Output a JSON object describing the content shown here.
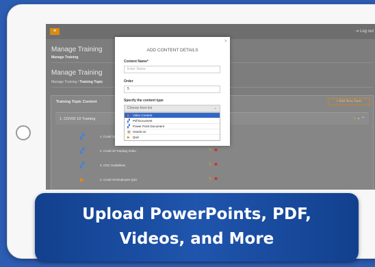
{
  "topbar": {
    "menu_glyph": "≡",
    "login_label": "Log out"
  },
  "page": {
    "title_1": "Manage Training",
    "subtitle_1": "Manage Training",
    "title_2": "Manage Training",
    "breadcrumb": [
      "Manage Training",
      "/",
      "Training Topic"
    ]
  },
  "panel": {
    "title": "Training Topic Content",
    "add_button": "+ Add New Topic",
    "topic": "1. COVID 19 Training",
    "items": [
      {
        "label": "1. Covid 19 C",
        "icon": "pdf-icon"
      },
      {
        "label": "2. Covid 19 Training Video",
        "icon": "pdf-icon"
      },
      {
        "label": "3. CDC Guidelines",
        "icon": "pdf-icon"
      },
      {
        "label": "4. Covid 19 Employee Quiz",
        "icon": "quiz-icon"
      }
    ]
  },
  "modal": {
    "close": "×",
    "title": "ADD CONTENT DETAILS",
    "content_name_label": "Content Name*",
    "content_name_placeholder": "Enter Name",
    "order_label": "Order",
    "order_value": "5",
    "type_label": "Specify the content type",
    "type_placeholder": "Choose from list",
    "options": [
      {
        "label": "Video Content",
        "selected": true,
        "icon": "video-icon"
      },
      {
        "label": "Pdf Document",
        "selected": false,
        "icon": "pdf-icon"
      },
      {
        "label": "Power Point Document",
        "selected": false,
        "icon": "powerpoint-icon"
      },
      {
        "label": "Hands-on",
        "selected": false,
        "icon": "hands-on-icon"
      },
      {
        "label": "Quiz",
        "selected": false,
        "icon": "quiz-icon"
      }
    ]
  },
  "banner": {
    "line_1": "Upload PowerPoints, PDF,",
    "line_2": "Videos, and More"
  },
  "colors": {
    "background": "#2c5db3",
    "banner": "#1a4c9e",
    "accent": "#d98b14",
    "selection": "#2f66c8",
    "delete": "#d62424"
  }
}
